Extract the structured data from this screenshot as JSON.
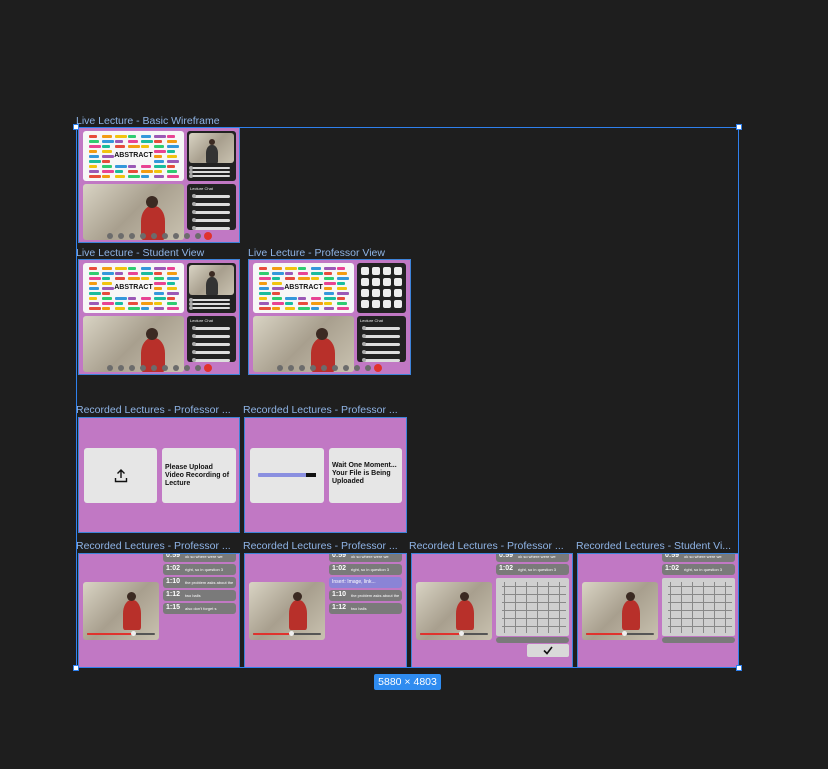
{
  "frames": {
    "basic": {
      "label": "Live Lecture - Basic Wireframe"
    },
    "student": {
      "label": "Live Lecture - Student View"
    },
    "professor": {
      "label": "Live Lecture - Professor View"
    },
    "upload": {
      "label": "Recorded Lectures - Professor ...",
      "text": "Please Upload Video Recording of Lecture"
    },
    "uploading": {
      "label": "Recorded Lectures - Professor ...",
      "text": "Wait One Moment... Your File is Being Uploaded",
      "progress": 0.82
    },
    "rec1": {
      "label": "Recorded Lectures - Professor ..."
    },
    "rec2": {
      "label": "Recorded Lectures - Professor ..."
    },
    "rec3": {
      "label": "Recorded Lectures - Professor ..."
    },
    "rec4": {
      "label": "Recorded Lectures - Student Vi..."
    }
  },
  "slide": {
    "title": "ABSTRACT"
  },
  "chat": {
    "title": "Lecture Chat"
  },
  "transcripts": {
    "rec1": [
      {
        "time": "0:59",
        "text": "ok so where were we"
      },
      {
        "time": "1:02",
        "text": "right, so in question 3"
      },
      {
        "time": "1:10",
        "text": "the problem asks about the"
      },
      {
        "time": "1:12",
        "text": "two balls"
      },
      {
        "time": "1:15",
        "text": "also don't forget s"
      }
    ],
    "rec2": [
      {
        "time": "0:59",
        "text": "ok so where were we"
      },
      {
        "time": "1:02",
        "text": "right, so in question 3"
      },
      {
        "time": "",
        "text": "Insert: Image, link...",
        "highlight": true
      },
      {
        "time": "1:10",
        "text": "the problem asks about the"
      },
      {
        "time": "1:12",
        "text": "two balls"
      }
    ],
    "rec3": [
      {
        "time": "0:59",
        "text": "ok so where were we"
      },
      {
        "time": "1:02",
        "text": "right, so in question 3"
      }
    ],
    "rec4": [
      {
        "time": "0:59",
        "text": "ok so where were we"
      },
      {
        "time": "1:02",
        "text": "right, so in question 3"
      }
    ]
  },
  "video_progress": {
    "rec1": 0.85,
    "rec2": 0.7,
    "rec3": 0.75,
    "rec4": 0.7
  },
  "icons": {
    "upload": "upload-icon",
    "check": "check-icon"
  },
  "canvas": {
    "dimensions": "5880 × 4803"
  },
  "colors": {
    "frame_bg": "#c178c4",
    "selection": "#2f80ed",
    "record_red": "#e0322d"
  }
}
